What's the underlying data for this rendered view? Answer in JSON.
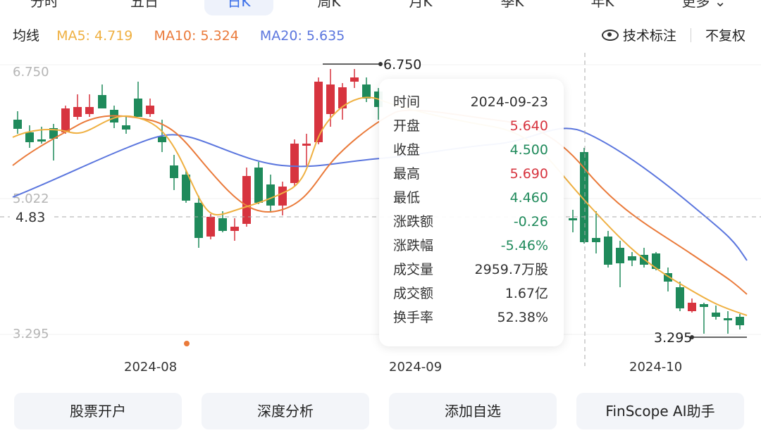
{
  "tabs": [
    {
      "label": "分时"
    },
    {
      "label": "五日"
    },
    {
      "label": "日K"
    },
    {
      "label": "周K"
    },
    {
      "label": "月K"
    },
    {
      "label": "季K"
    },
    {
      "label": "年K"
    },
    {
      "label": "更多"
    }
  ],
  "ma": {
    "label": "均线",
    "ma5": "MA5: 4.719",
    "ma10": "MA10: 5.324",
    "ma20": "MA20: 5.635",
    "colors": {
      "ma5": "#efb041",
      "ma10": "#ea7a3a",
      "ma20": "#5b76de"
    }
  },
  "toolbar": {
    "tech_label": "技术标注",
    "adjust_label": "不复权"
  },
  "chart": {
    "y_top_label": "6.750",
    "y_mid_label": "5.022",
    "y_bottom_label": "3.295",
    "cursor_price": "4.83",
    "high_marker": "6.750",
    "low_marker": "3.295",
    "x_labels": [
      "2024-08",
      "2024-09",
      "2024-10"
    ],
    "colors": {
      "up": "#d7343f",
      "down": "#1f8a5b"
    }
  },
  "tooltip": {
    "rows": [
      {
        "key": "时间",
        "value": "2024-09-23"
      },
      {
        "key": "开盘",
        "value": "5.640"
      },
      {
        "key": "收盘",
        "value": "4.500"
      },
      {
        "key": "最高",
        "value": "5.690"
      },
      {
        "key": "最低",
        "value": "4.460"
      },
      {
        "key": "涨跌额",
        "value": "-0.26"
      },
      {
        "key": "涨跌幅",
        "value": "-5.46%"
      },
      {
        "key": "成交量",
        "value": "2959.7万股"
      },
      {
        "key": "成交额",
        "value": "1.67亿"
      },
      {
        "key": "换手率",
        "value": "52.38%"
      }
    ]
  },
  "buttons": [
    {
      "label": "股票开户"
    },
    {
      "label": "深度分析"
    },
    {
      "label": "添加自选"
    },
    {
      "label": "FinScope AI助手"
    }
  ]
}
